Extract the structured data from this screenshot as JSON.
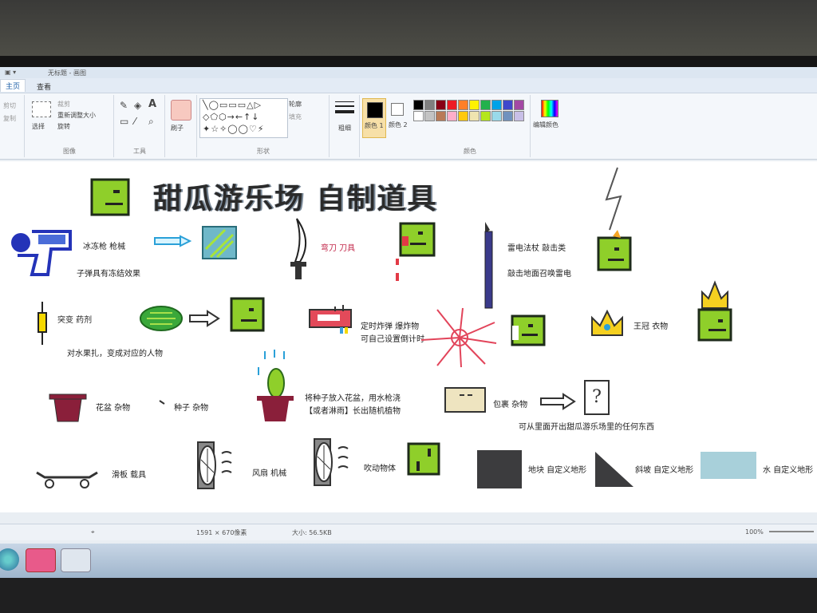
{
  "window": {
    "title": "无标题 - 画图"
  },
  "tabs": [
    {
      "label": "主页"
    },
    {
      "label": "查看"
    }
  ],
  "ribbon": {
    "clipboard": {
      "paste": "粘贴",
      "cut": "剪切",
      "copy": "复制"
    },
    "image": {
      "label": "图像",
      "select": "选择",
      "crop": "裁剪",
      "resize": "重新调整大小",
      "rotate": "旋转"
    },
    "tools": {
      "label": "工具"
    },
    "brushes": {
      "label": "刷子"
    },
    "shapes": {
      "label": "形状",
      "outline": "轮廓",
      "fill": "填充"
    },
    "size": {
      "label": "粗细"
    },
    "color1": {
      "label": "颜色 1"
    },
    "color2": {
      "label": "颜色 2"
    },
    "colors": {
      "label": "颜色"
    },
    "edit_colors": {
      "label": "编辑颜色"
    },
    "palette": [
      "#000000",
      "#7f7f7f",
      "#880015",
      "#ed1c24",
      "#ff7f27",
      "#fff200",
      "#22b14c",
      "#00a2e8",
      "#3f48cc",
      "#a349a4",
      "#ffffff",
      "#c3c3c3",
      "#b97a57",
      "#ffaec9",
      "#ffc90e",
      "#efe4b0",
      "#b5e61d",
      "#99d9ea",
      "#7092be",
      "#c8bfe7"
    ]
  },
  "canvas": {
    "title": "甜瓜游乐场  自制道具",
    "items": {
      "freeze_gun": "冰冻枪  枪械",
      "freeze_desc": "子弹具有冻结效果",
      "scimitar": "弯刀  刀具",
      "thunder_staff": "雷电法杖  敲击类",
      "thunder_desc": "敲击地面召唤雷电",
      "mutation": "突变  药剂",
      "mutation_desc": "对水果扎，变成对应的人物",
      "timed_bomb": "定时炸弹  爆炸物",
      "timed_bomb_desc": "可自己设置倒计时",
      "crown": "王冠  衣物",
      "flowerpot": "花盆  杂物",
      "seed": "种子  杂物",
      "seed_desc1": "将种子放入花盆，用水枪浇",
      "seed_desc2": "【或者淋雨】长出随机植物",
      "package": "包裹  杂物",
      "package_desc": "可从里面开出甜瓜游乐场里的任何东西",
      "question": "?",
      "skateboard": "滑板  载具",
      "fan": "风扇  机械",
      "blow": "吹动物体",
      "block": "地块  自定义地形",
      "slope": "斜坡  自定义地形",
      "water": "水  自定义地形"
    }
  },
  "status": {
    "dimensions": "1591 × 670像素",
    "size": "大小: 56.5KB",
    "zoom": "100%"
  }
}
